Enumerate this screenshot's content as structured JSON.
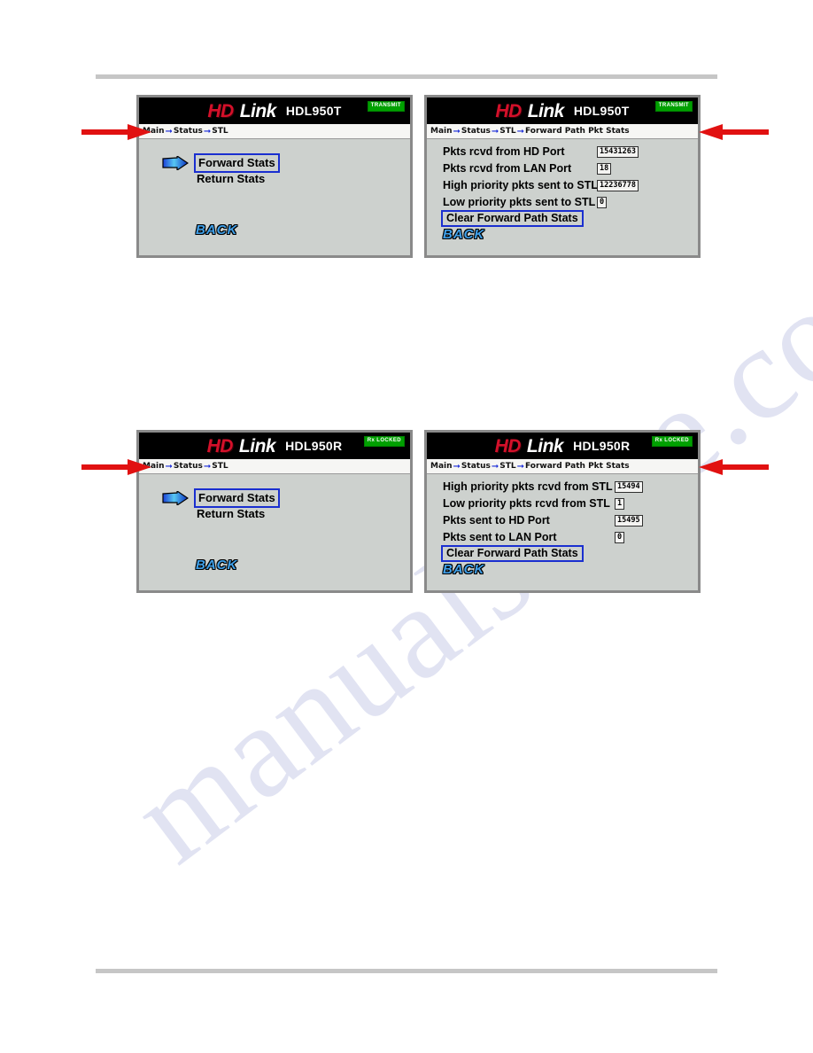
{
  "watermark": {
    "text": "manualshive.com"
  },
  "colors": {
    "panel_bg": "#cdd1ce",
    "titlebar_bg": "#000000",
    "logo_hd": "#d4102a",
    "logo_link": "#ffffff",
    "badge_green": "#00a000",
    "highlight_blue": "#1a2fd0",
    "back_blue": "#3f9fe8",
    "callout_red": "#e11111"
  },
  "panels": [
    {
      "id": "transmitter-stl-menu",
      "logo": {
        "hd": "HD",
        "link": "Link"
      },
      "model": "HDL950T",
      "badge": "TRANSMIT",
      "breadcrumb": [
        "Main",
        "Status",
        "STL"
      ],
      "type": "menu",
      "menu": {
        "selected": "Forward Stats",
        "items": [
          "Forward Stats",
          "Return Stats"
        ]
      },
      "back_label": "BACK"
    },
    {
      "id": "transmitter-forward-path-stats",
      "logo": {
        "hd": "HD",
        "link": "Link"
      },
      "model": "HDL950T",
      "badge": "TRANSMIT",
      "breadcrumb": [
        "Main",
        "Status",
        "STL",
        "Forward Path Pkt Stats"
      ],
      "type": "stats",
      "stats": [
        {
          "label": "Pkts rcvd from  HD Port",
          "value": "15431263"
        },
        {
          "label": "Pkts rcvd from  LAN Port",
          "value": "18"
        },
        {
          "label": "High priority pkts sent to STL",
          "value": "12236778"
        },
        {
          "label": "Low priority pkts sent to STL",
          "value": "0"
        }
      ],
      "clear_button": "Clear Forward Path Stats",
      "back_label": "BACK"
    },
    {
      "id": "receiver-stl-menu",
      "logo": {
        "hd": "HD",
        "link": "Link"
      },
      "model": "HDL950R",
      "badge": "Rx  LOCKED",
      "breadcrumb": [
        "Main",
        "Status",
        "STL"
      ],
      "type": "menu",
      "menu": {
        "selected": "Forward Stats",
        "items": [
          "Forward Stats",
          "Return Stats"
        ]
      },
      "back_label": "BACK"
    },
    {
      "id": "receiver-forward-path-stats",
      "logo": {
        "hd": "HD",
        "link": "Link"
      },
      "model": "HDL950R",
      "badge": "Rx  LOCKED",
      "breadcrumb": [
        "Main",
        "Status",
        "STL",
        "Forward Path Pkt Stats"
      ],
      "type": "stats",
      "stats": [
        {
          "label": "High priority pkts rcvd from STL",
          "value": "15494"
        },
        {
          "label": "Low priority pkts rcvd from STL",
          "value": "1"
        },
        {
          "label": "Pkts sent to HD Port",
          "value": "15495"
        },
        {
          "label": "Pkts sent to LAN Port",
          "value": "0"
        }
      ],
      "clear_button": "Clear Forward Path Stats",
      "back_label": "BACK"
    }
  ],
  "callouts": [
    {
      "id": "callout-left-top",
      "direction": "right"
    },
    {
      "id": "callout-right-top",
      "direction": "left"
    },
    {
      "id": "callout-left-bottom",
      "direction": "right"
    },
    {
      "id": "callout-right-bottom",
      "direction": "left"
    }
  ]
}
